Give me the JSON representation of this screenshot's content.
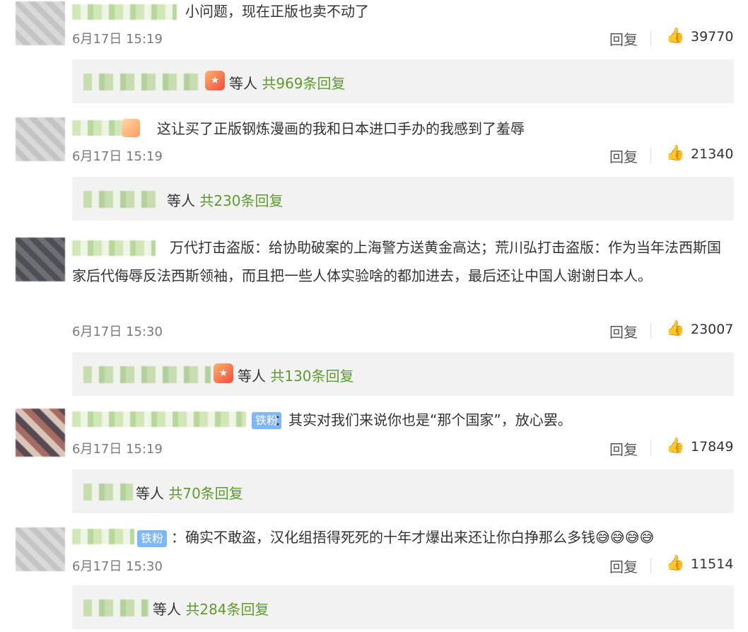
{
  "comments": [
    {
      "text": "小问题，现在正版也卖不动了",
      "time": "6月17日 15:19",
      "reply_label": "回复",
      "likes": "39770",
      "replies_label": "等人",
      "replies_count": "共969条回复"
    },
    {
      "text": "这让买了正版钢炼漫画的我和日本进口手办的我感到了羞辱",
      "time": "6月17日 15:19",
      "reply_label": "回复",
      "likes": "21340",
      "replies_label": "等人",
      "replies_count": "共230条回复"
    },
    {
      "text": "万代打击盗版：给协助破案的上海警方送黄金高达；荒川弘打击盗版：作为当年法西斯国家后代侮辱反法西斯领袖，而且把一些人体实验啥的都加进去，最后还让中国人谢谢日本人。",
      "time": "6月17日 15:30",
      "reply_label": "回复",
      "likes": "23007",
      "replies_label": "等人",
      "replies_count": "共130条回复"
    },
    {
      "tag": "铁粉",
      "text": "：其实对我们来说你也是“那个国家”，放心罢。",
      "time": "6月17日 15:19",
      "reply_label": "回复",
      "likes": "17849",
      "replies_label": "等人",
      "replies_count": "共70条回复"
    },
    {
      "tag": "铁粉",
      "text": "：确实不敢盗，汉化组捂得死死的十年才爆出来还让你白挣那么多钱😅😅😅😅",
      "time": "6月17日 15:30",
      "reply_label": "回复",
      "likes": "11514",
      "replies_label": "等人",
      "replies_count": "共284条回复"
    }
  ],
  "icons": {
    "like": "thumbs-up-icon",
    "badge": "fan-badge-icon"
  }
}
